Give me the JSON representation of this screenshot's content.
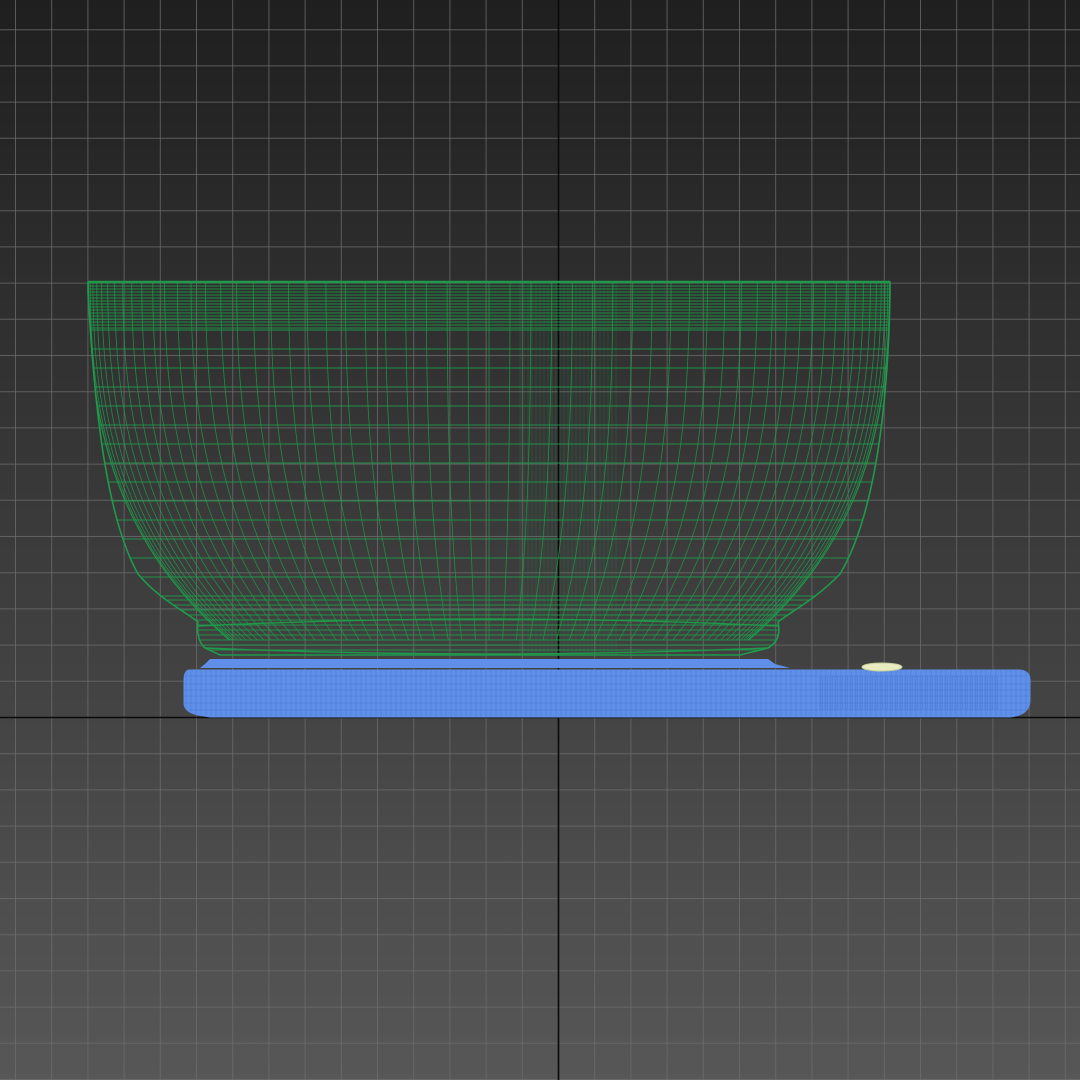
{
  "viewport": {
    "view": "front",
    "shading_mode": "wireframe",
    "background_gradient": [
      "#1f1f1f",
      "#575757"
    ],
    "grid_color": "#6e6e6e",
    "axis_color": "#0a0a0a",
    "grid_visible": true
  },
  "objects": [
    {
      "name": "bowl",
      "type": "wireframe-mesh",
      "wire_color": "#1f9a4a"
    },
    {
      "name": "tray",
      "type": "wireframe-mesh",
      "wire_color": "#5f8fe8"
    },
    {
      "name": "small-cylinder",
      "type": "wireframe-mesh",
      "wire_color": "#e8ecc0"
    }
  ]
}
